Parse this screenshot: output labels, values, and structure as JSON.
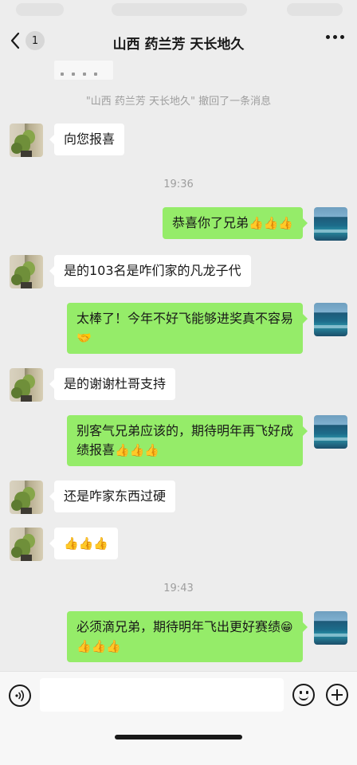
{
  "header": {
    "unread_count": "1",
    "title": "山西 药兰芳 天长地久"
  },
  "system_notice": "\"山西 药兰芳 天长地久\" 撤回了一条消息",
  "timestamps": [
    "19:36",
    "19:43"
  ],
  "messages": [
    {
      "side": "in",
      "text": "向您报喜",
      "emoji": ""
    },
    {
      "side": "out",
      "text": "恭喜你了兄弟",
      "emoji": "👍👍👍"
    },
    {
      "side": "in",
      "text": "是的103名是咋们家的凡龙子代",
      "emoji": ""
    },
    {
      "side": "out",
      "text": "太棒了！今年不好飞能够进奖真不容易",
      "emoji": "🤝"
    },
    {
      "side": "in",
      "text": "是的谢谢杜哥支持",
      "emoji": ""
    },
    {
      "side": "out",
      "text": "别客气兄弟应该的，期待明年再飞好成绩报喜",
      "emoji": "👍👍👍"
    },
    {
      "side": "in",
      "text": "还是咋家东西过硬",
      "emoji": ""
    },
    {
      "side": "in",
      "text": "",
      "emoji": "👍👍👍"
    },
    {
      "side": "out",
      "text": "必须滴兄弟，期待明年飞出更好赛绩",
      "emoji": "😁👍👍👍"
    }
  ],
  "colors": {
    "background": "#ededed",
    "outgoing_bubble": "#95ec69",
    "incoming_bubble": "#ffffff"
  },
  "icons": {
    "back": "chevron-left-icon",
    "more": "more-dots-icon",
    "voice": "voice-icon",
    "emoji": "emoji-icon",
    "plus": "plus-icon"
  }
}
